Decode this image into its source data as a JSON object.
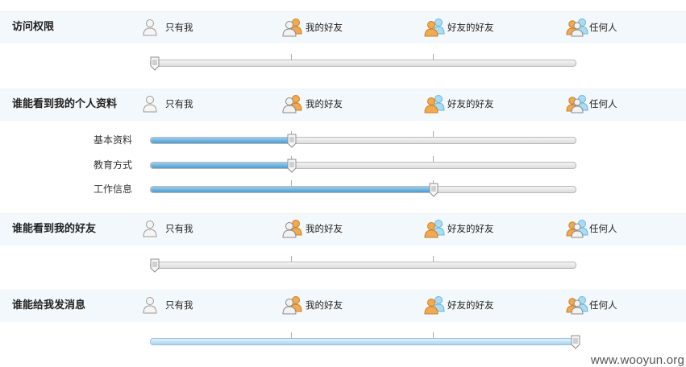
{
  "options": [
    "只有我",
    "我的好友",
    "好友的好友",
    "任何人"
  ],
  "sections": [
    {
      "title": "访问权限"
    },
    {
      "title": "谁能看到我的个人资料",
      "rows": [
        {
          "label": "基本资料",
          "level": 1
        },
        {
          "label": "教育方式",
          "level": 1
        },
        {
          "label": "工作信息",
          "level": 2
        }
      ]
    },
    {
      "title": "谁能看到我的好友"
    },
    {
      "title": "谁能给我发消息"
    }
  ],
  "sliders": {
    "access": 0,
    "profile_basic": 1,
    "profile_education": 1,
    "profile_work": 2,
    "friends": 0,
    "messages": 3
  },
  "colors": {
    "band": "#f3f8fc",
    "fill": "#4a9bd0",
    "friend_icon": "#f0a84f",
    "public_icon": "#8ecdf0",
    "me_icon": "#cfcfcf"
  },
  "icons": [
    "user-gray-icon",
    "friend-pair-icon",
    "friends-of-friends-icon",
    "everyone-icon"
  ],
  "watermark": "www.wooyun.org"
}
